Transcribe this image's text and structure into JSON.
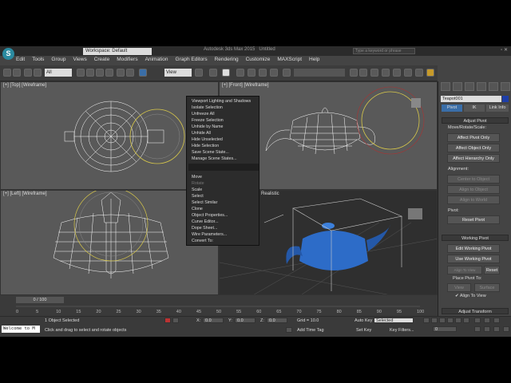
{
  "app": {
    "title": "Autodesk 3ds Max 2015",
    "document": "Untitled",
    "workspace": "Workspace: Default",
    "search_placeholder": "Type a keyword or phrase",
    "logo": "S"
  },
  "menu": [
    "Edit",
    "Tools",
    "Group",
    "Views",
    "Create",
    "Modifiers",
    "Animation",
    "Graph Editors",
    "Rendering",
    "Customize",
    "MAXScript",
    "Help"
  ],
  "toolbar": {
    "selection_filter": "All",
    "coord_system": "View"
  },
  "viewports": {
    "top": "[+] [Top] [Wireframe]",
    "front": "[+] [Front] [Wireframe]",
    "left": "[+] [Left] [Wireframe]",
    "persp": "Realistic"
  },
  "context_menu": {
    "items": [
      "Viewport Lighting and Shadows",
      "Isolate Selection",
      "Unfreeze All",
      "Freeze Selection",
      "Unhide by Name",
      "Unhide All",
      "Hide Unselected",
      "Hide Selection",
      "Save Scene State...",
      "Manage Scene States...",
      "Move",
      "Rotate",
      "Scale",
      "Select",
      "Select Similar",
      "Clone",
      "Object Properties...",
      "Curve Editor...",
      "Dope Sheet...",
      "Wire Parameters...",
      "Convert To:"
    ]
  },
  "panel": {
    "object_name": "Teapot001",
    "object_color": "#1e3ea8",
    "tabs": [
      "Pivot",
      "IK",
      "Link Info"
    ],
    "adjust_pivot": {
      "title": "Adjust Pivot",
      "move_label": "Move/Rotate/Scale:",
      "buttons": [
        "Affect Pivot Only",
        "Affect Object Only",
        "Affect Hierarchy Only"
      ],
      "alignment_label": "Alignment:",
      "align_buttons": [
        "Center to Object",
        "Align to Object",
        "Align to World"
      ],
      "pivot_label": "Pivot:",
      "reset_pivot": "Reset Pivot"
    },
    "working_pivot": {
      "title": "Working Pivot",
      "buttons": [
        "Edit Working Pivot",
        "Use Working Pivot"
      ],
      "align_to_view": "Align To View",
      "reset": "Reset",
      "place_label": "Place Pivot To:",
      "view": "View",
      "surface": "Surface",
      "align_check": "Align To View"
    },
    "adjust_transform": "Adjust Transform"
  },
  "timeline": {
    "frame": "0 / 100",
    "ticks": [
      "0",
      "5",
      "10",
      "15",
      "20",
      "25",
      "30",
      "35",
      "40",
      "45",
      "50",
      "55",
      "60",
      "65",
      "70",
      "75",
      "80",
      "85",
      "90",
      "95",
      "100"
    ]
  },
  "status": {
    "maxscript": "Welcome to M",
    "selected": "1 Object Selected",
    "prompt": "Click and drag to select and rotate objects",
    "x_label": "X:",
    "x": "0.0",
    "y_label": "Y:",
    "y": "0.0",
    "z_label": "Z:",
    "z": "0.0",
    "grid": "Grid = 10.0",
    "add_time_tag": "Add Time Tag",
    "auto_key": "Auto Key",
    "key_mode": "Selected",
    "set_key": "Set Key",
    "key_filters": "Key Filters...",
    "frame": "0"
  }
}
